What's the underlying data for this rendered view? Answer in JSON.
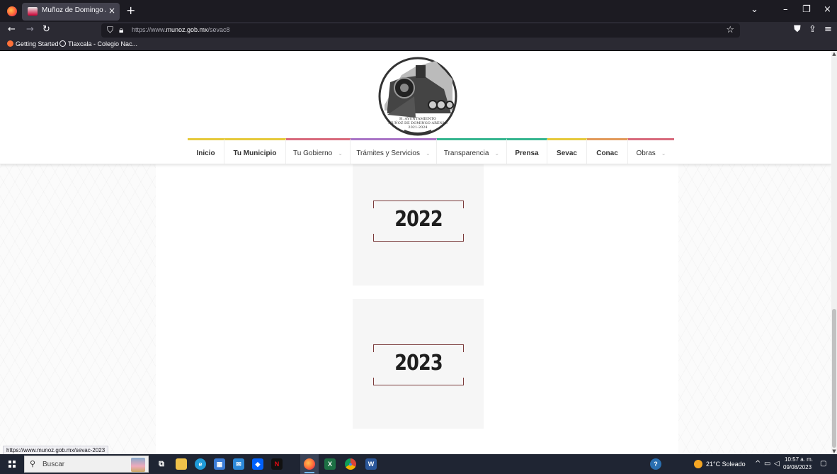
{
  "browser": {
    "tab_title": "Muñoz de Domingo Arenas",
    "tab_close": "×",
    "new_tab": "+",
    "tab_list": "⌄",
    "minimize": "–",
    "maximize": "❐",
    "close": "×",
    "back": "←",
    "forward": "→",
    "reload": "↻",
    "url_prefix": "https://www.",
    "url_domain": "munoz.gob.mx",
    "url_path": "/sevac8",
    "bookmarks": [
      {
        "label": "Getting Started",
        "color": "#ff7139"
      },
      {
        "label": "Tlaxcala - Colegio Nac...",
        "color": "#5c5c66"
      }
    ]
  },
  "site": {
    "logo_caption_1": "H. AYUNTAMIENTO",
    "logo_caption_2": "MUÑOZ DE DOMINGO ARENAS",
    "logo_caption_3": "2021-2024",
    "menu": [
      {
        "label": "Inicio",
        "color": "#e6c93b",
        "bold": true,
        "caret": ""
      },
      {
        "label": "Tu Municipio",
        "color": "#e6c93b",
        "bold": true,
        "caret": ""
      },
      {
        "label": "Tu Gobierno",
        "color": "#d86a7c",
        "bold": false,
        "caret": "⌄"
      },
      {
        "label": "Trámites y Servicios",
        "color": "#a974c6",
        "bold": false,
        "caret": "⌄"
      },
      {
        "label": "Transparencia",
        "color": "#35b58f",
        "bold": false,
        "caret": "⌄"
      },
      {
        "label": "Prensa",
        "color": "#35b58f",
        "bold": true,
        "caret": ""
      },
      {
        "label": "Sevac",
        "color": "#e6c93b",
        "bold": true,
        "caret": ""
      },
      {
        "label": "Conac",
        "color": "#e29a5a",
        "bold": true,
        "caret": ""
      },
      {
        "label": "Obras",
        "color": "#d86a7c",
        "bold": false,
        "caret": "⌄"
      }
    ],
    "cards": [
      {
        "year": "2022"
      },
      {
        "year": "2023"
      }
    ],
    "status_url": "https://www.munoz.gob.mx/sevac-2023"
  },
  "taskbar": {
    "search_placeholder": "Buscar",
    "weather": "21°C  Soleado",
    "time": "10:57 a. m.",
    "date": "09/08/2023",
    "apps": [
      {
        "name": "task-view",
        "color": "transparent",
        "glyph": "⧉"
      },
      {
        "name": "file-explorer",
        "color": "#f0c24a",
        "glyph": ""
      },
      {
        "name": "edge",
        "color": "#1f9bd9",
        "glyph": "e"
      },
      {
        "name": "store",
        "color": "#3a7bd5",
        "glyph": "▦"
      },
      {
        "name": "mail",
        "color": "#2b88d8",
        "glyph": "✉"
      },
      {
        "name": "dropbox",
        "color": "#0061fe",
        "glyph": "◆"
      },
      {
        "name": "netflix",
        "color": "#111",
        "glyph": "N"
      },
      {
        "name": "firefox",
        "color": "#ff7139",
        "glyph": ""
      },
      {
        "name": "excel",
        "color": "#1d7044",
        "glyph": "X"
      },
      {
        "name": "chrome",
        "color": "#e9b637",
        "glyph": "●"
      },
      {
        "name": "word",
        "color": "#2b579a",
        "glyph": "W"
      }
    ]
  }
}
